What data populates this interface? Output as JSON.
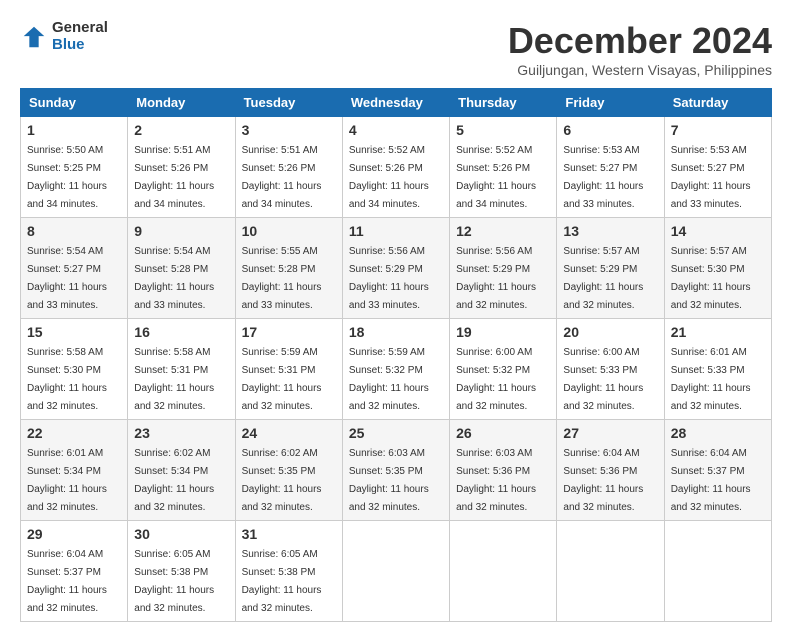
{
  "logo": {
    "general": "General",
    "blue": "Blue"
  },
  "title": "December 2024",
  "location": "Guiljungan, Western Visayas, Philippines",
  "weekdays": [
    "Sunday",
    "Monday",
    "Tuesday",
    "Wednesday",
    "Thursday",
    "Friday",
    "Saturday"
  ],
  "weeks": [
    [
      {
        "day": "1",
        "sunrise": "5:50 AM",
        "sunset": "5:25 PM",
        "daylight": "11 hours and 34 minutes."
      },
      {
        "day": "2",
        "sunrise": "5:51 AM",
        "sunset": "5:26 PM",
        "daylight": "11 hours and 34 minutes."
      },
      {
        "day": "3",
        "sunrise": "5:51 AM",
        "sunset": "5:26 PM",
        "daylight": "11 hours and 34 minutes."
      },
      {
        "day": "4",
        "sunrise": "5:52 AM",
        "sunset": "5:26 PM",
        "daylight": "11 hours and 34 minutes."
      },
      {
        "day": "5",
        "sunrise": "5:52 AM",
        "sunset": "5:26 PM",
        "daylight": "11 hours and 34 minutes."
      },
      {
        "day": "6",
        "sunrise": "5:53 AM",
        "sunset": "5:27 PM",
        "daylight": "11 hours and 33 minutes."
      },
      {
        "day": "7",
        "sunrise": "5:53 AM",
        "sunset": "5:27 PM",
        "daylight": "11 hours and 33 minutes."
      }
    ],
    [
      {
        "day": "8",
        "sunrise": "5:54 AM",
        "sunset": "5:27 PM",
        "daylight": "11 hours and 33 minutes."
      },
      {
        "day": "9",
        "sunrise": "5:54 AM",
        "sunset": "5:28 PM",
        "daylight": "11 hours and 33 minutes."
      },
      {
        "day": "10",
        "sunrise": "5:55 AM",
        "sunset": "5:28 PM",
        "daylight": "11 hours and 33 minutes."
      },
      {
        "day": "11",
        "sunrise": "5:56 AM",
        "sunset": "5:29 PM",
        "daylight": "11 hours and 33 minutes."
      },
      {
        "day": "12",
        "sunrise": "5:56 AM",
        "sunset": "5:29 PM",
        "daylight": "11 hours and 32 minutes."
      },
      {
        "day": "13",
        "sunrise": "5:57 AM",
        "sunset": "5:29 PM",
        "daylight": "11 hours and 32 minutes."
      },
      {
        "day": "14",
        "sunrise": "5:57 AM",
        "sunset": "5:30 PM",
        "daylight": "11 hours and 32 minutes."
      }
    ],
    [
      {
        "day": "15",
        "sunrise": "5:58 AM",
        "sunset": "5:30 PM",
        "daylight": "11 hours and 32 minutes."
      },
      {
        "day": "16",
        "sunrise": "5:58 AM",
        "sunset": "5:31 PM",
        "daylight": "11 hours and 32 minutes."
      },
      {
        "day": "17",
        "sunrise": "5:59 AM",
        "sunset": "5:31 PM",
        "daylight": "11 hours and 32 minutes."
      },
      {
        "day": "18",
        "sunrise": "5:59 AM",
        "sunset": "5:32 PM",
        "daylight": "11 hours and 32 minutes."
      },
      {
        "day": "19",
        "sunrise": "6:00 AM",
        "sunset": "5:32 PM",
        "daylight": "11 hours and 32 minutes."
      },
      {
        "day": "20",
        "sunrise": "6:00 AM",
        "sunset": "5:33 PM",
        "daylight": "11 hours and 32 minutes."
      },
      {
        "day": "21",
        "sunrise": "6:01 AM",
        "sunset": "5:33 PM",
        "daylight": "11 hours and 32 minutes."
      }
    ],
    [
      {
        "day": "22",
        "sunrise": "6:01 AM",
        "sunset": "5:34 PM",
        "daylight": "11 hours and 32 minutes."
      },
      {
        "day": "23",
        "sunrise": "6:02 AM",
        "sunset": "5:34 PM",
        "daylight": "11 hours and 32 minutes."
      },
      {
        "day": "24",
        "sunrise": "6:02 AM",
        "sunset": "5:35 PM",
        "daylight": "11 hours and 32 minutes."
      },
      {
        "day": "25",
        "sunrise": "6:03 AM",
        "sunset": "5:35 PM",
        "daylight": "11 hours and 32 minutes."
      },
      {
        "day": "26",
        "sunrise": "6:03 AM",
        "sunset": "5:36 PM",
        "daylight": "11 hours and 32 minutes."
      },
      {
        "day": "27",
        "sunrise": "6:04 AM",
        "sunset": "5:36 PM",
        "daylight": "11 hours and 32 minutes."
      },
      {
        "day": "28",
        "sunrise": "6:04 AM",
        "sunset": "5:37 PM",
        "daylight": "11 hours and 32 minutes."
      }
    ],
    [
      {
        "day": "29",
        "sunrise": "6:04 AM",
        "sunset": "5:37 PM",
        "daylight": "11 hours and 32 minutes."
      },
      {
        "day": "30",
        "sunrise": "6:05 AM",
        "sunset": "5:38 PM",
        "daylight": "11 hours and 32 minutes."
      },
      {
        "day": "31",
        "sunrise": "6:05 AM",
        "sunset": "5:38 PM",
        "daylight": "11 hours and 32 minutes."
      },
      null,
      null,
      null,
      null
    ]
  ]
}
